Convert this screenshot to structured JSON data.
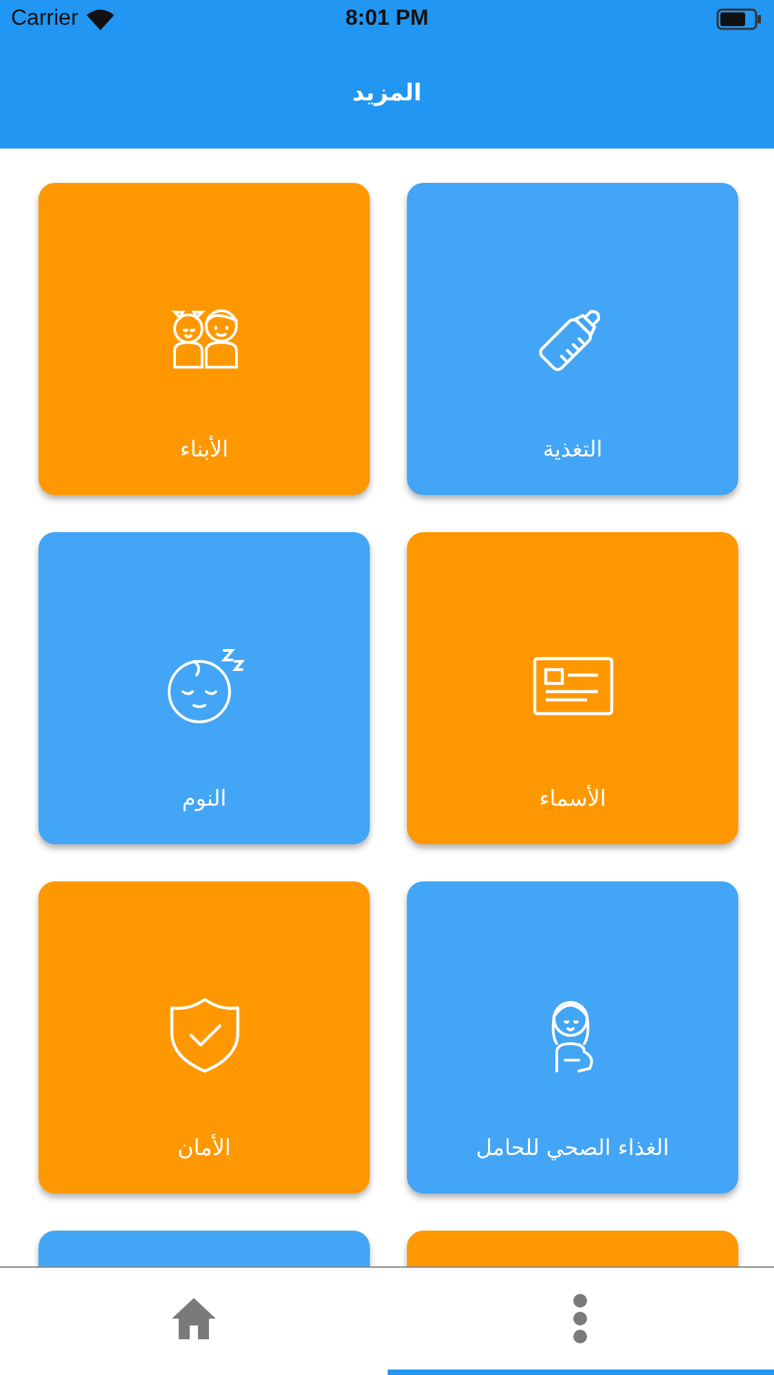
{
  "status_bar": {
    "carrier": "Carrier",
    "time": "8:01 PM"
  },
  "header": {
    "title": "المزيد"
  },
  "cards": [
    {
      "label": "التغذية",
      "kind": "bottle",
      "color": "#42a5f5"
    },
    {
      "label": "الأبناء",
      "kind": "kids",
      "color": "#ff9800"
    },
    {
      "label": "الأسماء",
      "kind": "card",
      "color": "#ff9800"
    },
    {
      "label": "النوم",
      "kind": "sleep",
      "color": "#42a5f5"
    },
    {
      "label": "الغذاء الصحي للحامل",
      "kind": "pregnant",
      "color": "#42a5f5"
    },
    {
      "label": "الأمان",
      "kind": "shield",
      "color": "#ff9800"
    },
    {
      "kind": "none",
      "color": "#ff9800"
    },
    {
      "kind": "none",
      "color": "#42a5f5"
    }
  ],
  "tabs": [
    {
      "kind": "home",
      "selected": false
    },
    {
      "kind": "more",
      "selected": true
    }
  ]
}
